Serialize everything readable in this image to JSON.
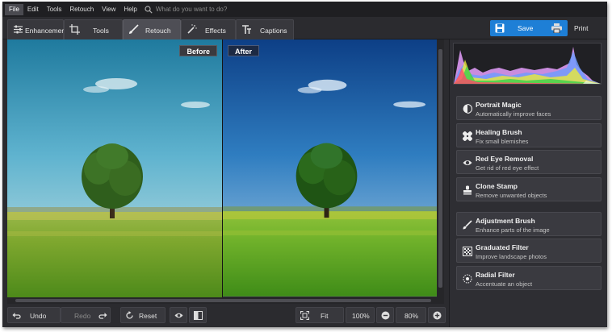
{
  "menu": [
    "File",
    "Edit",
    "Tools",
    "Retouch",
    "View",
    "Help"
  ],
  "search": {
    "placeholder": "What do you want to do?"
  },
  "tabs": [
    {
      "label": "Enhancement",
      "icon": "sliders-icon"
    },
    {
      "label": "Tools",
      "icon": "crop-icon"
    },
    {
      "label": "Retouch",
      "icon": "brush-icon",
      "selected": true
    },
    {
      "label": "Effects",
      "icon": "magic-wand-icon"
    },
    {
      "label": "Captions",
      "icon": "text-icon"
    }
  ],
  "actions": {
    "save": "Save",
    "print": "Print"
  },
  "viewer": {
    "before": "Before",
    "after": "After"
  },
  "bottom": {
    "undo": "Undo",
    "redo": "Redo",
    "reset": "Reset",
    "fit": "Fit",
    "zoom_full": "100%",
    "zoom_current": "80%"
  },
  "tools": [
    {
      "title": "Portrait Magic",
      "desc": "Automatically improve faces",
      "icon": "face-icon"
    },
    {
      "title": "Healing Brush",
      "desc": "Fix small blemishes",
      "icon": "bandage-icon"
    },
    {
      "title": "Red Eye Removal",
      "desc": "Get rid of red eye effect",
      "icon": "eye-icon"
    },
    {
      "title": "Clone Stamp",
      "desc": "Remove unwanted objects",
      "icon": "stamp-icon"
    },
    {
      "title": "Adjustment Brush",
      "desc": "Enhance parts of the image",
      "icon": "brush-icon"
    },
    {
      "title": "Graduated Filter",
      "desc": "Improve landscape photos",
      "icon": "gradient-icon"
    },
    {
      "title": "Radial Filter",
      "desc": "Accentuate an object",
      "icon": "radial-icon"
    }
  ],
  "colors": {
    "accent": "#1e7fd6",
    "panel": "#2b2b2f"
  }
}
